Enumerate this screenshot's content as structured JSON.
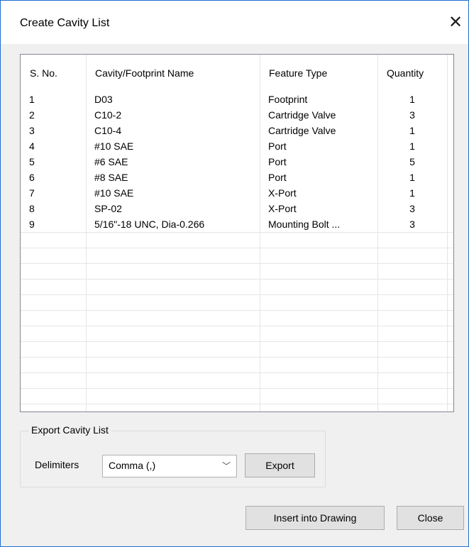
{
  "window": {
    "title": "Create Cavity List",
    "close_glyph": "✕"
  },
  "table": {
    "columns": [
      "S. No.",
      "Cavity/Footprint Name",
      "Feature Type",
      "Quantity"
    ],
    "rows": [
      {
        "sno": "1",
        "name": "D03",
        "type": "Footprint",
        "qty": "1"
      },
      {
        "sno": "2",
        "name": "C10-2",
        "type": "Cartridge Valve",
        "qty": "3"
      },
      {
        "sno": "3",
        "name": "C10-4",
        "type": "Cartridge Valve",
        "qty": "1"
      },
      {
        "sno": "4",
        "name": "#10 SAE",
        "type": "Port",
        "qty": "1"
      },
      {
        "sno": "5",
        "name": "#6 SAE",
        "type": "Port",
        "qty": "5"
      },
      {
        "sno": "6",
        "name": "#8 SAE",
        "type": "Port",
        "qty": "1"
      },
      {
        "sno": "7",
        "name": "#10 SAE",
        "type": "X-Port",
        "qty": "1"
      },
      {
        "sno": "8",
        "name": "SP-02",
        "type": "X-Port",
        "qty": "3"
      },
      {
        "sno": "9",
        "name": "5/16\"-18 UNC, Dia-0.266",
        "type": "Mounting Bolt ...",
        "qty": "3"
      }
    ]
  },
  "export": {
    "group_label": "Export Cavity List",
    "delimiters_label": "Delimiters",
    "delimiter_value": "Comma (,)",
    "export_label": "Export"
  },
  "buttons": {
    "insert_label": "Insert into Drawing",
    "close_label": "Close"
  },
  "colors": {
    "border": "#1e6fd0",
    "dialog_bg": "#f0f0f0",
    "button_bg": "#e1e1e1"
  }
}
